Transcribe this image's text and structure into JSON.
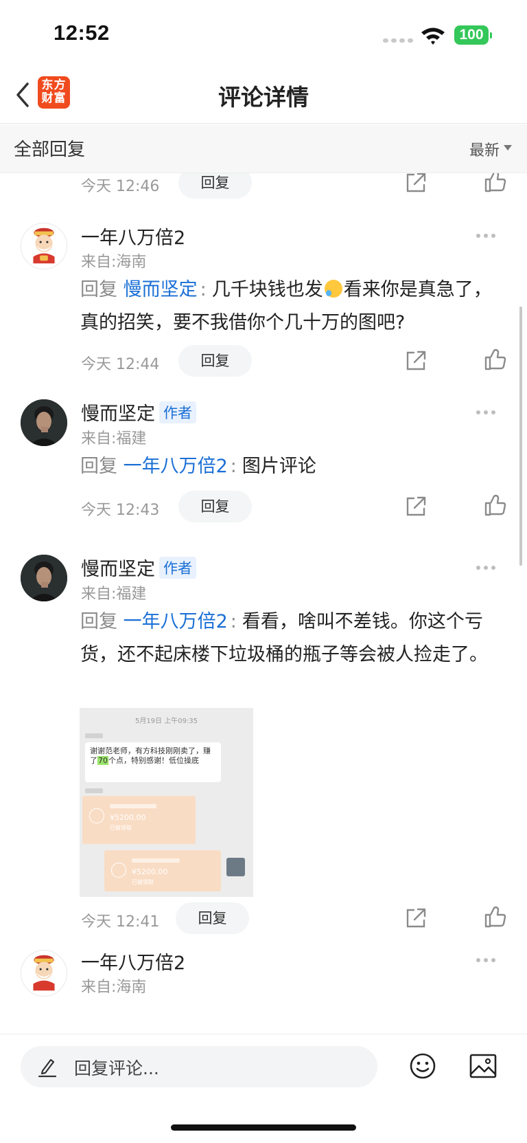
{
  "status_bar": {
    "time": "12:52",
    "battery": "100"
  },
  "nav": {
    "logo_line1": "东方",
    "logo_line2": "财富",
    "title": "评论详情"
  },
  "section": {
    "title": "全部回复",
    "sort": "最新"
  },
  "comments": [
    {
      "time": "今天 12:46",
      "reply_label": "回复"
    },
    {
      "name": "一年八万倍2",
      "location": "来自:海南",
      "reply_prefix": "回复",
      "reply_to": "慢而坚定",
      "text_a": "几千块钱也发",
      "text_b": "看来你是真急了，真的招笑，要不我借你个几十万的图吧?",
      "time": "今天 12:44",
      "reply_label": "回复"
    },
    {
      "name": "慢而坚定",
      "badge": "作者",
      "location": "来自:福建",
      "reply_prefix": "回复",
      "reply_to": "一年八万倍2",
      "text": "图片评论",
      "time": "今天 12:43",
      "reply_label": "回复"
    },
    {
      "name": "慢而坚定",
      "badge": "作者",
      "location": "来自:福建",
      "reply_prefix": "回复",
      "reply_to": "一年八万倍2",
      "text": "看看，啥叫不差钱。你这个亏货，还不起床楼下垃圾桶的瓶子等会被人捡走了。",
      "image": {
        "date": "5月19日 上午09:35",
        "msg_a": "谢谢范老师，有方科技刚刚卖了，赚了",
        "msg_hl": "70",
        "msg_b": "个点，特别感谢！低位操底",
        "amount1": "¥5200.00",
        "status1": "已被领取",
        "amount2": "¥5200.00",
        "status2": "已被领取"
      },
      "time": "今天 12:41",
      "reply_label": "回复"
    },
    {
      "name": "一年八万倍2",
      "location": "来自:海南"
    }
  ],
  "bottom": {
    "placeholder": "回复评论..."
  }
}
